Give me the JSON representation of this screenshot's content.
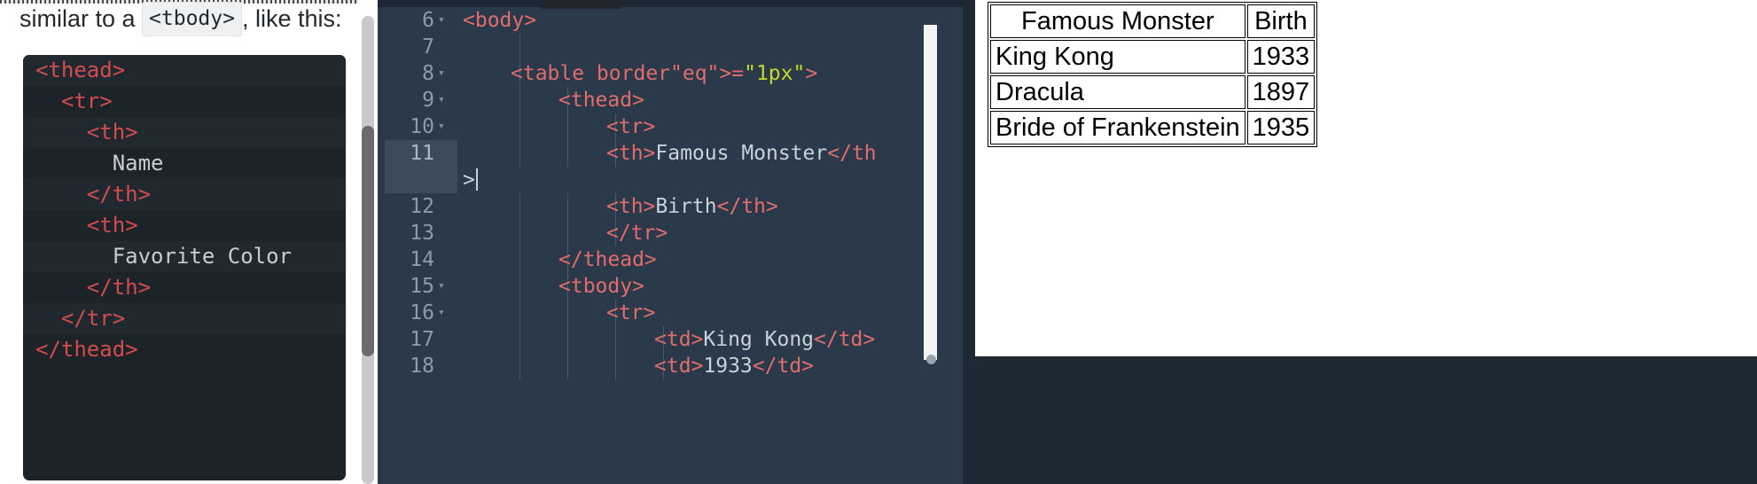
{
  "article": {
    "lead_before": "similar to a",
    "lead_code": "<tbody>",
    "lead_after": ", like this:",
    "code_lines": [
      {
        "text": "<thead>",
        "shade": true
      },
      {
        "text": "  <tr>",
        "shade": false
      },
      {
        "text": "    <th>",
        "shade": true
      },
      {
        "text": "      Name",
        "shade": false,
        "plain": true
      },
      {
        "text": "    </th>",
        "shade": true
      },
      {
        "text": "    <th>",
        "shade": false
      },
      {
        "text": "      Favorite Color",
        "shade": true,
        "plain": true
      },
      {
        "text": "    </th>",
        "shade": false
      },
      {
        "text": "  </tr>",
        "shade": true
      },
      {
        "text": "</thead>",
        "shade": false
      }
    ]
  },
  "editor": {
    "lines": [
      {
        "num": "6",
        "fold": "▾",
        "active": false,
        "code": "<body>",
        "indent": 0,
        "guides": 0
      },
      {
        "num": "7",
        "fold": "",
        "active": false,
        "code": "",
        "indent": 0,
        "guides": 1
      },
      {
        "num": "8",
        "fold": "▾",
        "active": false,
        "code": "<table border=\"1px\">",
        "indent": 1,
        "guides": 1
      },
      {
        "num": "9",
        "fold": "▾",
        "active": false,
        "code": "<thead>",
        "indent": 2,
        "guides": 2
      },
      {
        "num": "10",
        "fold": "▾",
        "active": false,
        "code": "<tr>",
        "indent": 3,
        "guides": 3
      },
      {
        "num": "11",
        "fold": "",
        "active": true,
        "code": "<th>Famous Monster</th",
        "indent": 3,
        "guides": 3
      },
      {
        "num": "",
        "fold": "",
        "active": true,
        "code": ">",
        "indent": 0,
        "guides": 0,
        "wrap": true
      },
      {
        "num": "12",
        "fold": "",
        "active": false,
        "code": "<th>Birth</th>",
        "indent": 3,
        "guides": 3
      },
      {
        "num": "13",
        "fold": "",
        "active": false,
        "code": "</tr>",
        "indent": 3,
        "guides": 3
      },
      {
        "num": "14",
        "fold": "",
        "active": false,
        "code": "</thead>",
        "indent": 2,
        "guides": 2
      },
      {
        "num": "15",
        "fold": "▾",
        "active": false,
        "code": "<tbody>",
        "indent": 2,
        "guides": 2
      },
      {
        "num": "16",
        "fold": "▾",
        "active": false,
        "code": "<tr>",
        "indent": 3,
        "guides": 3
      },
      {
        "num": "17",
        "fold": "",
        "active": false,
        "code": "<td>King Kong</td>",
        "indent": 4,
        "guides": 4
      },
      {
        "num": "18",
        "fold": "",
        "active": false,
        "code": "<td>1933</td>",
        "indent": 4,
        "guides": 4
      }
    ]
  },
  "preview": {
    "table": {
      "headers": [
        "Famous Monster",
        "Birth"
      ],
      "rows": [
        [
          "King Kong",
          "1933"
        ],
        [
          "Dracula",
          "1897"
        ],
        [
          "Bride of Frankenstein",
          "1935"
        ]
      ]
    }
  },
  "colors": {
    "editor_bg": "#2b3a4a",
    "codeblock_bg": "#1d2429",
    "tag_red": "#e06c6c",
    "string_yellow": "#c3d82c",
    "equals_cyan": "#7fd6d6",
    "active_line": "#3b4b5c"
  }
}
